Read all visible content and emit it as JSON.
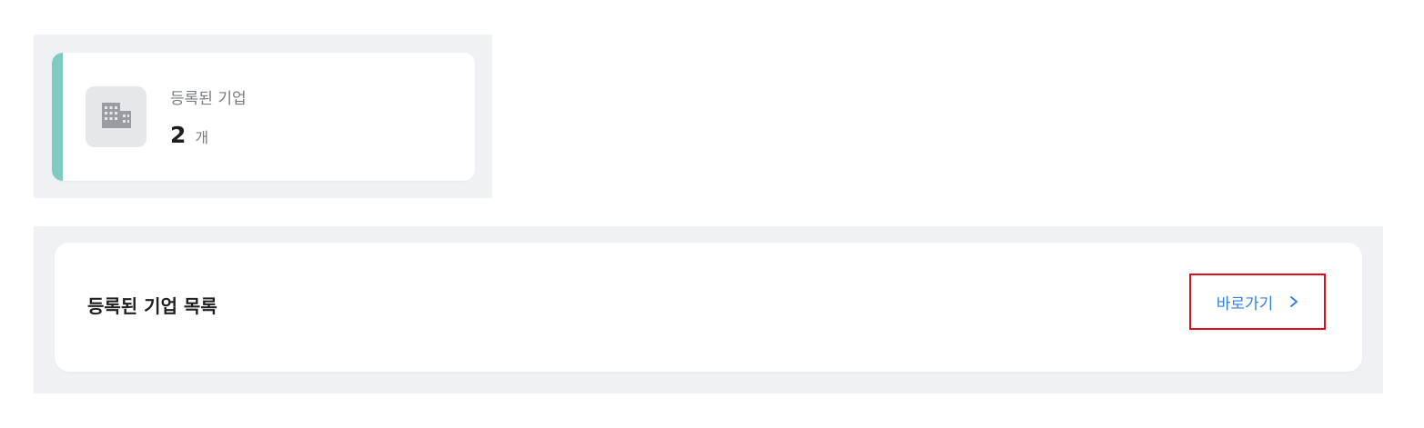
{
  "summary_card": {
    "label": "등록된 기업",
    "value": "2",
    "unit": "개",
    "icon": "building-icon",
    "accent_color": "#7ecbc0"
  },
  "company_list": {
    "title": "등록된 기업 목록",
    "go_label": "바로가기",
    "go_icon": "chevron-right-icon",
    "link_color": "#2f80e8",
    "highlight_color": "#e0101a"
  }
}
